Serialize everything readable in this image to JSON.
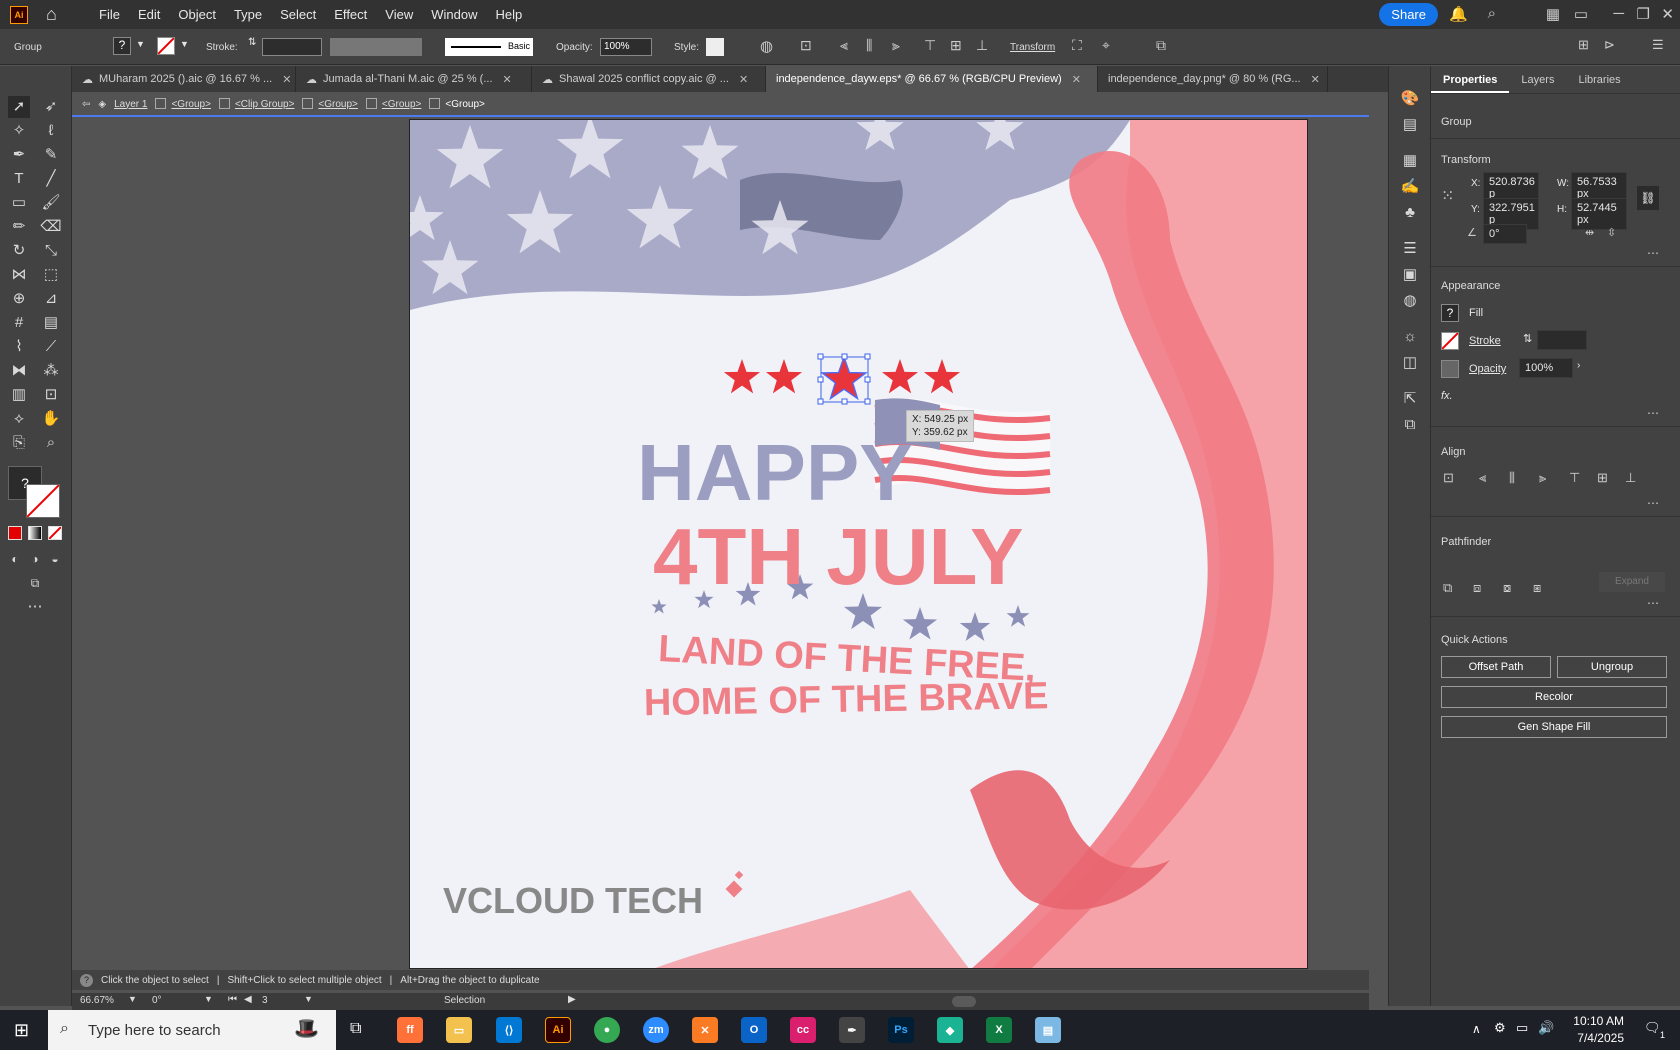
{
  "menubar": {
    "items": [
      "File",
      "Edit",
      "Object",
      "Type",
      "Select",
      "Effect",
      "View",
      "Window",
      "Help"
    ],
    "share_label": "Share",
    "logo": "Ai"
  },
  "control_bar": {
    "selection_type": "Group",
    "stroke_label": "Stroke:",
    "brush_label": "Basic",
    "opacity_label": "Opacity:",
    "opacity_value": "100%",
    "style_label": "Style:",
    "transform_label": "Transform"
  },
  "tabs": [
    {
      "label": "MUharam 2025 ().aic @ 16.67 % ..."
    },
    {
      "label": "Jumada al-Thani M.aic @ 25 % (..."
    },
    {
      "label": "Shawal 2025 conflict copy.aic @ ..."
    },
    {
      "label": "independence_dayw.eps* @ 66.67 % (RGB/CPU Preview)",
      "active": true
    },
    {
      "label": "independence_day.png* @ 80 % (RG..."
    }
  ],
  "breadcrumb": {
    "layer": "Layer 1",
    "items": [
      "<Group>",
      "<Clip Group>",
      "<Group>",
      "<Group>",
      "<Group>"
    ]
  },
  "artwork": {
    "happy": "HAPPY",
    "fourth": "4TH JULY",
    "line1": "LAND OF THE FREE,",
    "line2": "HOME OF THE BRAVE",
    "brand": "VCLOUD TECH"
  },
  "tooltip": {
    "x": "X: 549.25 px",
    "y": "Y: 359.62 px"
  },
  "panel": {
    "tabs": [
      "Properties",
      "Layers",
      "Libraries"
    ],
    "selection": "Group",
    "transform_title": "Transform",
    "x_label": "X:",
    "x_value": "520.8736 p",
    "y_label": "Y:",
    "y_value": "322.7951 p",
    "w_label": "W:",
    "w_value": "56.7533 px",
    "h_label": "H:",
    "h_value": "52.7445 px",
    "angle_value": "0°",
    "appearance_title": "Appearance",
    "fill_label": "Fill",
    "stroke_label": "Stroke",
    "opacity_label": "Opacity",
    "opacity_value": "100%",
    "fx_label": "fx.",
    "align_title": "Align",
    "pathfinder_title": "Pathfinder",
    "expand_label": "Expand",
    "quick_actions_title": "Quick Actions",
    "offset_path": "Offset Path",
    "ungroup": "Ungroup",
    "recolor": "Recolor",
    "gen_shape_fill": "Gen Shape Fill"
  },
  "status": {
    "hint1": "Click the object to select",
    "hint2": "Shift+Click to select multiple object",
    "hint3": "Alt+Drag the object to duplicate",
    "zoom": "66.67%",
    "rotation": "0°",
    "artboard": "3",
    "tool": "Selection"
  },
  "taskbar": {
    "search_placeholder": "Type here to search",
    "time": "10:10 AM",
    "date": "7/4/2025",
    "notif": "1"
  },
  "colors": {
    "red": "#e8343b",
    "pink": "#f08088",
    "lavender": "#9b9ec0",
    "accent": "#1473e6"
  }
}
